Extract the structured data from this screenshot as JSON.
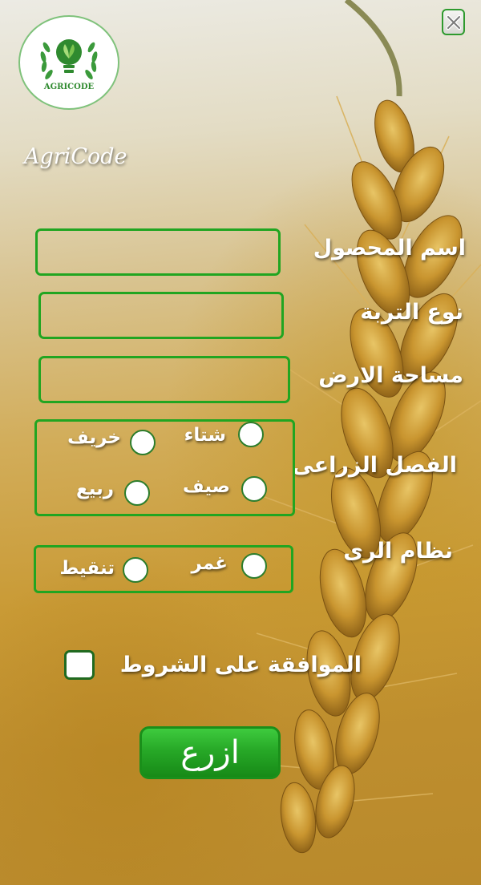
{
  "app": {
    "logo_text": "AGRICODE",
    "title": "AgriCode"
  },
  "close_button": {
    "icon": "close-icon"
  },
  "form": {
    "crop_name": {
      "label": "اسم المحصول",
      "value": ""
    },
    "soil_type": {
      "label": "نوع التربة",
      "value": ""
    },
    "land_area": {
      "label": "مساحة الارض",
      "value": ""
    },
    "season": {
      "label": "الفصل الزراعى",
      "options": [
        {
          "label": "شتاء",
          "checked": false
        },
        {
          "label": "خريف",
          "checked": false
        },
        {
          "label": "صيف",
          "checked": false
        },
        {
          "label": "ربيع",
          "checked": false
        }
      ]
    },
    "irrigation": {
      "label": "نظام الرى",
      "options": [
        {
          "label": "غمر",
          "checked": false
        },
        {
          "label": "تنقيط",
          "checked": false
        }
      ]
    },
    "terms": {
      "label": "الموافقة على الشروط",
      "checked": false
    },
    "submit_label": "ازرع"
  },
  "colors": {
    "accent": "#21a521",
    "button": "#27a827",
    "text": "#ffffff"
  }
}
